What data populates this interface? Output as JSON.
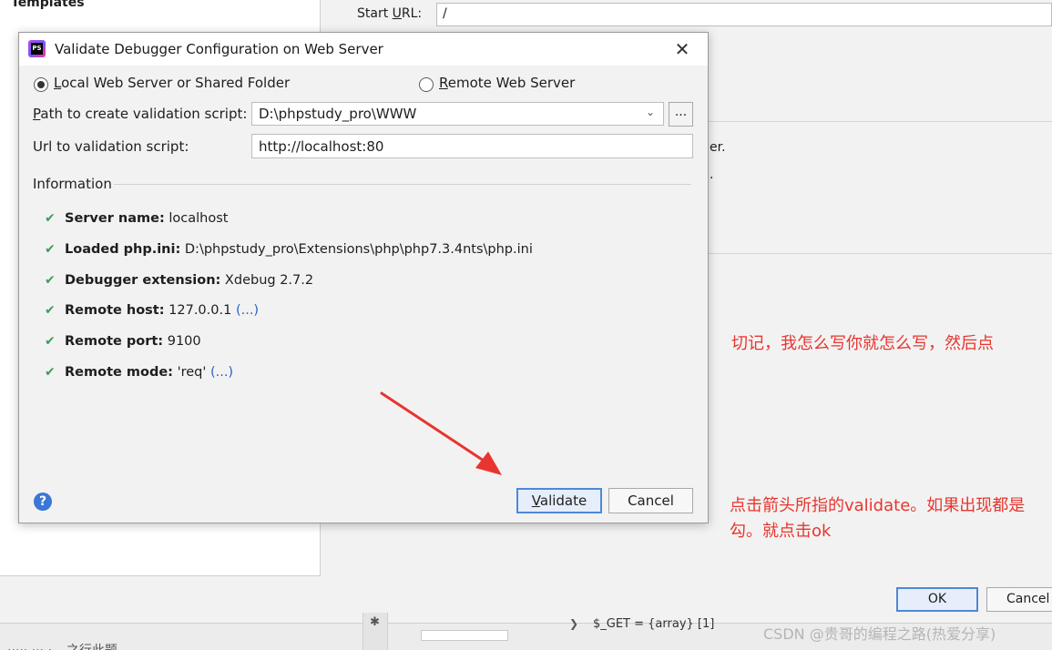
{
  "background": {
    "templates_label": "Templates",
    "start_url_label": "Start URL:",
    "start_url_value": "/",
    "fragment_1": "er.",
    "fragment_2": ".",
    "bottom_left_text": "····· ··· · – 之行此题",
    "ok_button": "OK",
    "cancel_button": "Cancel",
    "debug_var": "$_GET = {array} [1]"
  },
  "dialog": {
    "title": "Validate Debugger Configuration on Web Server",
    "app_icon_text": "PS",
    "radio_local": {
      "prefix": "L",
      "rest": "ocal Web Server or Shared Folder",
      "checked": true
    },
    "radio_remote": {
      "prefix": "R",
      "rest": "emote Web Server",
      "checked": false
    },
    "path_label_prefix": "P",
    "path_label_rest": "ath to create validation script:",
    "path_value": "D:\\phpstudy_pro\\WWW",
    "browse_label": "...",
    "url_label": "Url to validation script:",
    "url_value": "http://localhost:80",
    "information_heading": "Information",
    "info_rows": [
      {
        "key": "Server name:",
        "value": " localhost",
        "link": ""
      },
      {
        "key": "Loaded php.ini:",
        "value": " D:\\phpstudy_pro\\Extensions\\php\\php7.3.4nts\\php.ini",
        "link": ""
      },
      {
        "key": "Debugger extension:",
        "value": " Xdebug 2.7.2",
        "link": ""
      },
      {
        "key": "Remote host:",
        "value": " 127.0.0.1 ",
        "link": "(...)"
      },
      {
        "key": "Remote port:",
        "value": " 9100",
        "link": ""
      },
      {
        "key": "Remote mode:",
        "value": " 'req' ",
        "link": "(...)"
      }
    ],
    "help_label": "?",
    "validate_button_prefix": "V",
    "validate_button_rest": "alidate",
    "cancel_button": "Cancel"
  },
  "annotations": {
    "note_1": "切记，我怎么写你就怎么写，然后点",
    "note_2": "点击箭头所指的validate。如果出现都是勾。就点击ok",
    "watermark": "CSDN @贵哥的编程之路(热爱分享)"
  },
  "colors": {
    "accent_blue": "#4f88d6",
    "check_green": "#3f9b5c",
    "annotation_red": "#e8352f",
    "link_blue": "#2f5fc4"
  },
  "icons": {
    "check": "check-icon",
    "help": "help-icon",
    "close": "close-icon",
    "chevron": "chevron-down-icon"
  }
}
